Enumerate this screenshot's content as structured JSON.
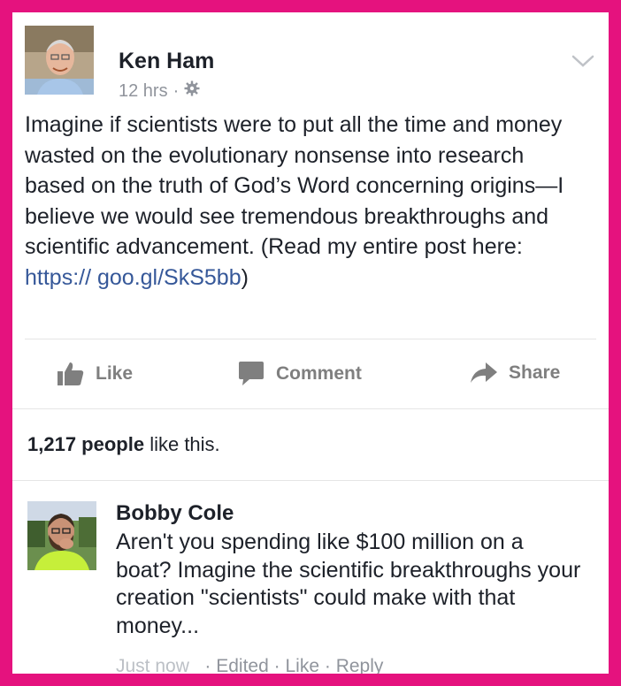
{
  "post": {
    "author": "Ken Ham",
    "time": "12 hrs",
    "separator": "·",
    "text_before_link": "Imagine if scientists were to put all the time and money wasted on the evolutionary nonsense into research based on the truth of God’s Word concerning origins—I believe we would see tremendous breakthroughs and scientific advancement. (Read my entire post here: ",
    "link": "https:// goo.gl/SkS5bb",
    "text_after_link": ")"
  },
  "actions": {
    "like": "Like",
    "comment": "Comment",
    "share": "Share"
  },
  "likes_summary": {
    "count": "1,217 people",
    "suffix": " like this."
  },
  "comment": {
    "author": "Bobby Cole",
    "text": "Aren't you spending like $100 million on a boat? Imagine the scientific breakthroughs your creation \"scientists\" could make with that money...",
    "time": "Just now",
    "edited": "Edited",
    "like": "Like",
    "reply": "Reply",
    "dot": "·"
  },
  "colors": {
    "frame": "#e5127e",
    "link": "#365899",
    "muted": "#90949c"
  }
}
